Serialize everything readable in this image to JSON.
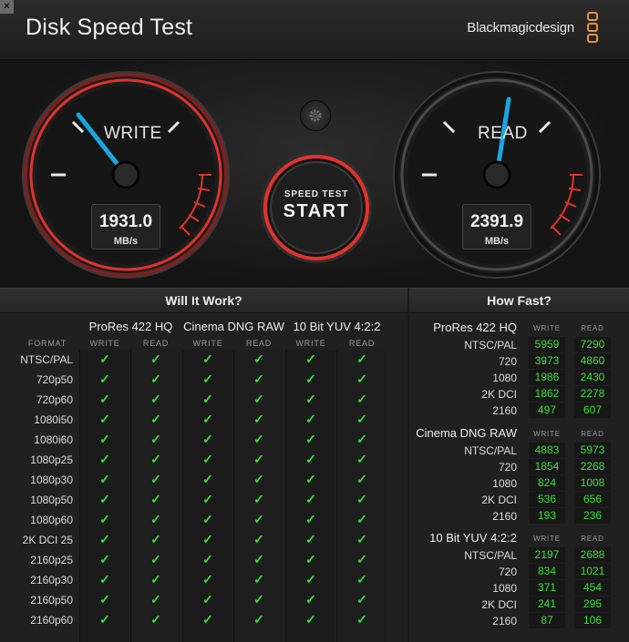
{
  "header": {
    "close_glyph": "×",
    "title": "Disk Speed Test",
    "brand": "Blackmagicdesign"
  },
  "gauges": {
    "write": {
      "label": "WRITE",
      "value": "1931.0",
      "unit": "MB/s",
      "needle_fraction": 0.23
    },
    "read": {
      "label": "READ",
      "value": "2391.9",
      "unit": "MB/s",
      "needle_fraction": 0.44
    }
  },
  "start_button": {
    "small_label": "SPEED TEST",
    "big_label": "START"
  },
  "settings": {
    "icon": "gear-icon"
  },
  "colors": {
    "accent_red": "#e0332c",
    "needle_blue": "#1aa6e0",
    "check_green": "#3ce03c",
    "brand_orange": "#e3953c"
  },
  "will_it_work": {
    "title": "Will It Work?",
    "format_header": "FORMAT",
    "groups": [
      {
        "name": "ProRes 422 HQ",
        "write": "WRITE",
        "read": "READ"
      },
      {
        "name": "Cinema DNG RAW",
        "write": "WRITE",
        "read": "READ"
      },
      {
        "name": "10 Bit YUV 4:2:2",
        "write": "WRITE",
        "read": "READ"
      }
    ],
    "check_glyph": "✓",
    "formats": [
      "NTSC/PAL",
      "720p50",
      "720p60",
      "1080i50",
      "1080i60",
      "1080p25",
      "1080p30",
      "1080p50",
      "1080p60",
      "2K DCI 25",
      "2160p25",
      "2160p30",
      "2160p50",
      "2160p60"
    ]
  },
  "how_fast": {
    "title": "How Fast?",
    "write_header": "WRITE",
    "read_header": "READ",
    "groups": [
      {
        "name": "ProRes 422 HQ",
        "rows": [
          {
            "label": "NTSC/PAL",
            "write": "5959",
            "read": "7290"
          },
          {
            "label": "720",
            "write": "3973",
            "read": "4860"
          },
          {
            "label": "1080",
            "write": "1986",
            "read": "2430"
          },
          {
            "label": "2K DCI",
            "write": "1862",
            "read": "2278"
          },
          {
            "label": "2160",
            "write": "497",
            "read": "607"
          }
        ]
      },
      {
        "name": "Cinema DNG RAW",
        "rows": [
          {
            "label": "NTSC/PAL",
            "write": "4883",
            "read": "5973"
          },
          {
            "label": "720",
            "write": "1854",
            "read": "2268"
          },
          {
            "label": "1080",
            "write": "824",
            "read": "1008"
          },
          {
            "label": "2K DCI",
            "write": "536",
            "read": "656"
          },
          {
            "label": "2160",
            "write": "193",
            "read": "236"
          }
        ]
      },
      {
        "name": "10 Bit YUV 4:2:2",
        "rows": [
          {
            "label": "NTSC/PAL",
            "write": "2197",
            "read": "2688"
          },
          {
            "label": "720",
            "write": "834",
            "read": "1021"
          },
          {
            "label": "1080",
            "write": "371",
            "read": "454"
          },
          {
            "label": "2K DCI",
            "write": "241",
            "read": "295"
          },
          {
            "label": "2160",
            "write": "87",
            "read": "106"
          }
        ]
      }
    ]
  }
}
